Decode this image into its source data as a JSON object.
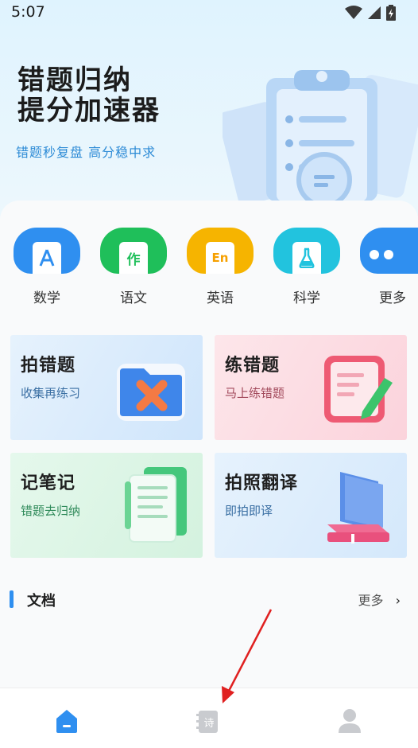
{
  "status_bar": {
    "time": "5:07"
  },
  "hero": {
    "title_line1": "错题归纳",
    "title_line2": "提分加速器",
    "subtitle": "错题秒复盘  高分稳中求"
  },
  "subjects": [
    {
      "label": "数学",
      "glyph": "A",
      "color": "#2f8ff0"
    },
    {
      "label": "语文",
      "glyph": "作",
      "color": "#1fbf5a"
    },
    {
      "label": "英语",
      "glyph": "En",
      "color": "#f6b400"
    },
    {
      "label": "科学",
      "glyph": "flask-icon",
      "color": "#22c3de"
    },
    {
      "label": "更多",
      "glyph": "dots-icon",
      "color": "#2f8ff0"
    }
  ],
  "features": [
    {
      "title": "拍错题",
      "subtitle": "收集再练习",
      "sub_color": "#3a6fa3"
    },
    {
      "title": "练错题",
      "subtitle": "马上练错题",
      "sub_color": "#a24a5c"
    },
    {
      "title": "记笔记",
      "subtitle": "错题去归纳",
      "sub_color": "#2f8a5a"
    },
    {
      "title": "拍照翻译",
      "subtitle": "即拍即译",
      "sub_color": "#3a6fa3"
    }
  ],
  "docs": {
    "title": "文档",
    "more": "更多",
    "more_icon": "chevron-right-icon"
  },
  "tabbar": [
    {
      "name": "home-icon",
      "active": true
    },
    {
      "name": "poem-book-icon",
      "glyph": "诗",
      "active": false
    },
    {
      "name": "profile-icon",
      "active": false
    }
  ]
}
